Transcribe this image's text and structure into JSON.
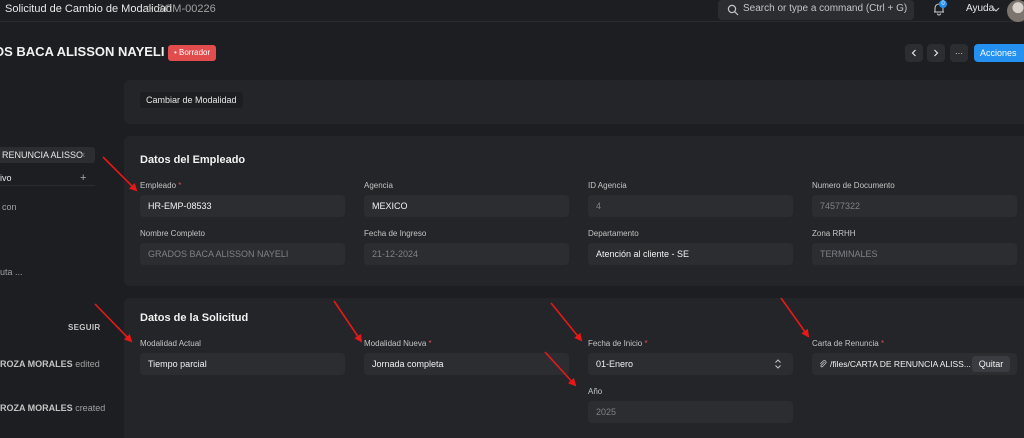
{
  "navbar": {
    "breadcrumb_1": "Solicitud de Cambio de Modalidad",
    "breadcrumb_sep": ">",
    "breadcrumb_2": "SCM-00226",
    "search_placeholder": "Search or type a command (Ctrl + G)",
    "notification_count": "0",
    "help_label": "Ayuda"
  },
  "header": {
    "title": "OS BACA ALISSON NAYELI",
    "status": "• Borrador",
    "more_label": "···",
    "actions_label": "Acciones"
  },
  "sidebar": {
    "attachment_tag": "RENUNCIA ALISSO",
    "attachment_close": "×",
    "row_label": "ivo",
    "row_plus": "+",
    "text_1": "con",
    "text_2": "uta ...",
    "follow_label": "SEGUIR",
    "activity": [
      {
        "name": "ROZA MORALES",
        "action": "edited"
      },
      {
        "name": "ROZA MORALES",
        "action": "created"
      }
    ]
  },
  "top_card": {
    "tab_label": "Cambiar de Modalidad"
  },
  "employee": {
    "section_title": "Datos del Empleado",
    "empleado_label": "Empleado",
    "empleado_value": "HR-EMP-08533",
    "agencia_label": "Agencia",
    "agencia_value": "MEXICO",
    "id_agencia_label": "ID Agencia",
    "id_agencia_value": "4",
    "numero_doc_label": "Numero de Documento",
    "numero_doc_value": "74577322",
    "nombre_label": "Nombre Completo",
    "nombre_value": "GRADOS BACA ALISSON NAYELI",
    "fecha_ingreso_label": "Fecha de Ingreso",
    "fecha_ingreso_value": "21-12-2024",
    "departamento_label": "Departamento",
    "departamento_value": "Atención al cliente - SE",
    "zona_label": "Zona RRHH",
    "zona_value": "TERMINALES"
  },
  "request": {
    "section_title": "Datos de la Solicitud",
    "modalidad_actual_label": "Modalidad Actual",
    "modalidad_actual_value": "Tiempo parcial",
    "modalidad_nueva_label": "Modalidad Nueva",
    "modalidad_nueva_value": "Jornada completa",
    "fecha_inicio_label": "Fecha de Inicio",
    "fecha_inicio_value": "01-Enero",
    "carta_label": "Carta de Renuncia",
    "carta_value": "/files/CARTA DE RENUNCIA ALISS...",
    "quitar_label": "Quitar",
    "anio_label": "Año",
    "anio_value": "2025"
  },
  "required_mark": "*",
  "colors": {
    "primary": "#2490ef",
    "danger": "#e24c4c",
    "annotation": "#e81818"
  }
}
